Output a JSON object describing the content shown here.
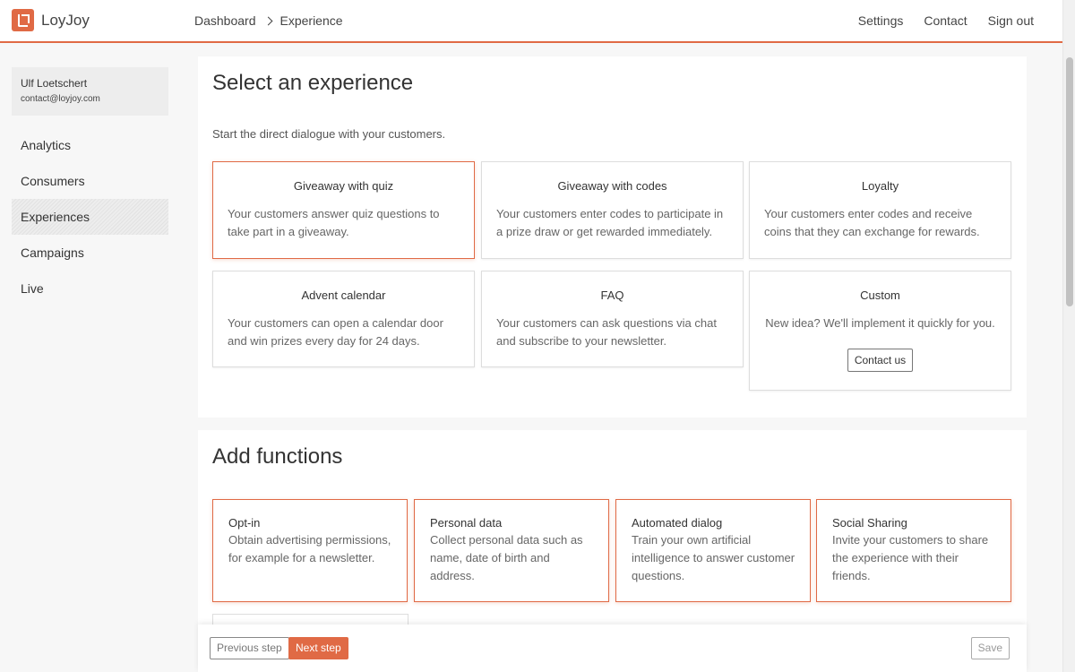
{
  "app": {
    "name": "LoyJoy",
    "brand_color": "#e06a45"
  },
  "breadcrumb": [
    "Dashboard",
    "Experience"
  ],
  "topnav": [
    "Settings",
    "Contact",
    "Sign out"
  ],
  "user": {
    "name": "Ulf Loetschert",
    "email": "contact@loyjoy.com"
  },
  "sidebar": {
    "items": [
      {
        "label": "Analytics",
        "active": false
      },
      {
        "label": "Consumers",
        "active": false
      },
      {
        "label": "Experiences",
        "active": true
      },
      {
        "label": "Campaigns",
        "active": false
      },
      {
        "label": "Live",
        "active": false
      }
    ]
  },
  "experience": {
    "title": "Select an experience",
    "subtitle": "Start the direct dialogue with your customers.",
    "cards": [
      {
        "title": "Giveaway with quiz",
        "desc": "Your customers answer quiz questions to take part in a giveaway.",
        "selected": true
      },
      {
        "title": "Giveaway with codes",
        "desc": "Your customers enter codes to participate in a prize draw or get rewarded immediately."
      },
      {
        "title": "Loyalty",
        "desc": "Your customers enter codes and receive coins that they can exchange for rewards."
      },
      {
        "title": "Advent calendar",
        "desc": "Your customers can open a calendar door and win prizes every day for 24 days."
      },
      {
        "title": "FAQ",
        "desc": "Your customers can ask questions via chat and subscribe to your newsletter."
      },
      {
        "title": "Custom",
        "desc": "New idea? We'll implement it quickly for you.",
        "button": "Contact us"
      }
    ]
  },
  "functions": {
    "title": "Add functions",
    "cards": [
      {
        "title": "Opt-in",
        "desc": "Obtain advertising permissions, for example for a newsletter."
      },
      {
        "title": "Personal data",
        "desc": "Collect personal data such as name, date of birth and address."
      },
      {
        "title": "Automated dialog",
        "desc": "Train your own artificial intelligence to answer customer questions."
      },
      {
        "title": "Social Sharing",
        "desc": "Invite your customers to share the experience with their friends."
      }
    ]
  },
  "actions": {
    "previous": "Previous step",
    "next": "Next step",
    "save": "Save"
  }
}
